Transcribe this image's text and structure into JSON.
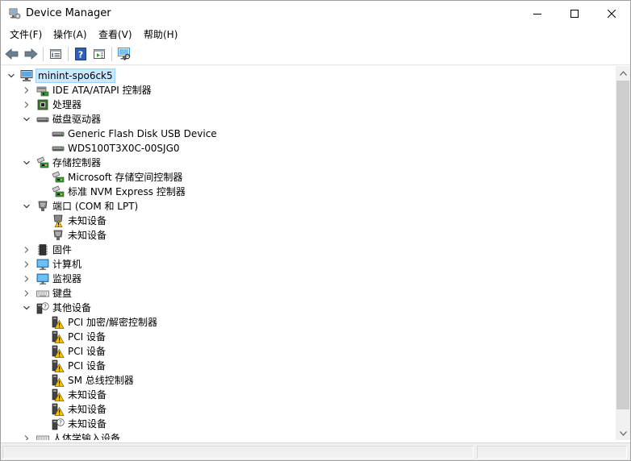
{
  "window": {
    "title": "Device Manager",
    "controls": [
      "minimize",
      "maximize",
      "close"
    ]
  },
  "menubar": {
    "items": [
      {
        "label": "文件(F)"
      },
      {
        "label": "操作(A)"
      },
      {
        "label": "查看(V)"
      },
      {
        "label": "帮助(H)"
      }
    ]
  },
  "toolbar": {
    "buttons": [
      {
        "icon": "back-arrow-icon"
      },
      {
        "icon": "forward-arrow-icon"
      },
      {
        "icon": "properties-icon"
      },
      {
        "icon": "help-icon"
      },
      {
        "icon": "show-hide-pane-icon"
      },
      {
        "icon": "scan-hardware-icon"
      }
    ]
  },
  "tree": {
    "root": {
      "label": "minint-spo6ck5",
      "icon": "computer-icon",
      "expanded": true,
      "selected": true
    },
    "items": [
      {
        "label": "IDE ATA/ATAPI 控制器",
        "icon": "ide-controller-icon",
        "level": 1,
        "expander": "collapsed"
      },
      {
        "label": "处理器",
        "icon": "processor-icon",
        "level": 1,
        "expander": "collapsed"
      },
      {
        "label": "磁盘驱动器",
        "icon": "disk-drive-icon",
        "level": 1,
        "expander": "expanded"
      },
      {
        "label": "Generic Flash Disk USB Device",
        "icon": "disk-drive-icon",
        "level": 2,
        "expander": "none"
      },
      {
        "label": "WDS100T3X0C-00SJG0",
        "icon": "disk-drive-icon",
        "level": 2,
        "expander": "none"
      },
      {
        "label": "存储控制器",
        "icon": "storage-controller-icon",
        "level": 1,
        "expander": "expanded"
      },
      {
        "label": "Microsoft 存储空间控制器",
        "icon": "storage-controller-icon",
        "level": 2,
        "expander": "none"
      },
      {
        "label": "标准 NVM Express 控制器",
        "icon": "storage-controller-icon",
        "level": 2,
        "expander": "none"
      },
      {
        "label": "端口 (COM 和 LPT)",
        "icon": "port-icon",
        "level": 1,
        "expander": "expanded"
      },
      {
        "label": "未知设备",
        "icon": "port-warning-icon",
        "level": 2,
        "expander": "none"
      },
      {
        "label": "未知设备",
        "icon": "port-icon",
        "level": 2,
        "expander": "none"
      },
      {
        "label": "固件",
        "icon": "firmware-icon",
        "level": 1,
        "expander": "collapsed"
      },
      {
        "label": "计算机",
        "icon": "monitor-icon",
        "level": 1,
        "expander": "collapsed"
      },
      {
        "label": "监视器",
        "icon": "monitor-icon",
        "level": 1,
        "expander": "collapsed"
      },
      {
        "label": "键盘",
        "icon": "keyboard-icon",
        "level": 1,
        "expander": "collapsed"
      },
      {
        "label": "其他设备",
        "icon": "unknown-device-icon",
        "level": 1,
        "expander": "expanded"
      },
      {
        "label": "PCI 加密/解密控制器",
        "icon": "warning-device-icon",
        "level": 2,
        "expander": "none"
      },
      {
        "label": "PCI 设备",
        "icon": "warning-device-icon",
        "level": 2,
        "expander": "none"
      },
      {
        "label": "PCI 设备",
        "icon": "warning-device-icon",
        "level": 2,
        "expander": "none"
      },
      {
        "label": "PCI 设备",
        "icon": "warning-device-icon",
        "level": 2,
        "expander": "none"
      },
      {
        "label": "SM 总线控制器",
        "icon": "warning-device-icon",
        "level": 2,
        "expander": "none"
      },
      {
        "label": "未知设备",
        "icon": "warning-device-icon",
        "level": 2,
        "expander": "none"
      },
      {
        "label": "未知设备",
        "icon": "warning-device-icon",
        "level": 2,
        "expander": "none"
      },
      {
        "label": "未知设备",
        "icon": "unknown-device-icon",
        "level": 2,
        "expander": "none"
      },
      {
        "label": "人体学输入设备",
        "icon": "hid-icon",
        "level": 1,
        "expander": "collapsed"
      }
    ]
  },
  "colors": {
    "selection_bg": "#cce8ff",
    "selection_border": "#99d1ff",
    "warning": "#f5c400",
    "monitor": "#3c9be0"
  }
}
